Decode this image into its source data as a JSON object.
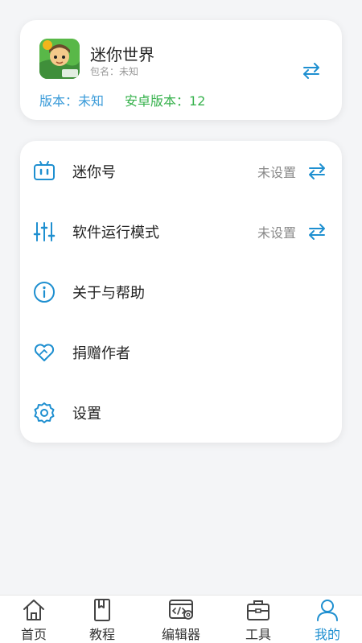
{
  "colors": {
    "accent": "#1e8fd0",
    "version_blue": "#3a9bd9",
    "version_green": "#37b24d"
  },
  "app": {
    "name": "迷你世界",
    "package": "包名：未知",
    "version": "版本：未知",
    "android_version": "安卓版本：12",
    "icon": "game-app-icon"
  },
  "menu": {
    "items": [
      {
        "label": "迷你号",
        "value": "未设置",
        "icon": "robot-id-icon"
      },
      {
        "label": "软件运行模式",
        "value": "未设置",
        "icon": "sliders-icon"
      },
      {
        "label": "关于与帮助",
        "icon": "info-icon"
      },
      {
        "label": "捐赠作者",
        "icon": "heart-icon"
      },
      {
        "label": "设置",
        "icon": "gear-icon"
      }
    ]
  },
  "tabs": [
    {
      "label": "首页",
      "icon": "home-icon"
    },
    {
      "label": "教程",
      "icon": "book-icon"
    },
    {
      "label": "编辑器",
      "icon": "code-editor-icon"
    },
    {
      "label": "工具",
      "icon": "toolbox-icon"
    },
    {
      "label": "我的",
      "icon": "user-icon",
      "active": true
    }
  ]
}
